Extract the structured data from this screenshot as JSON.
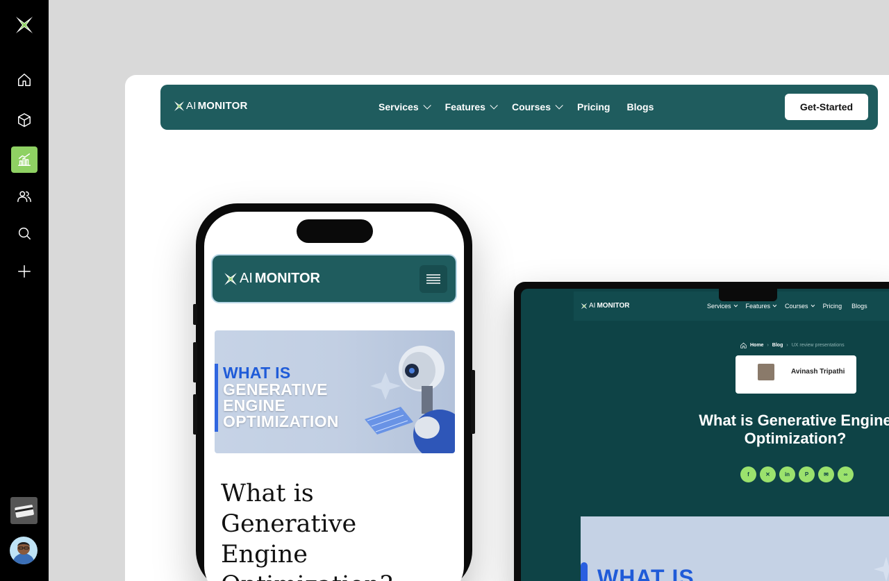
{
  "app_sidebar": {
    "items": [
      {
        "name": "home",
        "icon": "home-icon"
      },
      {
        "name": "products",
        "icon": "box-icon"
      },
      {
        "name": "analytics",
        "icon": "chart-icon",
        "active": true
      },
      {
        "name": "users",
        "icon": "users-icon"
      },
      {
        "name": "search",
        "icon": "search-icon"
      },
      {
        "name": "add",
        "icon": "plus-icon"
      }
    ],
    "accent_color": "#8fd163"
  },
  "site": {
    "logo_ai": "AI",
    "logo_name": "MONITOR",
    "nav": {
      "services": "Services",
      "features": "Features",
      "courses": "Courses",
      "pricing": "Pricing",
      "blogs": "Blogs"
    },
    "cta": "Get-Started",
    "brand_color": "#1f5c5e"
  },
  "phone": {
    "hero_line1": "WHAT IS",
    "hero_line2": "GENERATIVE",
    "hero_line3": "ENGINE",
    "hero_line4": "OPTIMIZATION",
    "title": "What is Generative Engine Optimization?"
  },
  "laptop": {
    "breadcrumb": {
      "home": "Home",
      "blog": "Blog",
      "current": "UX review presentations"
    },
    "author": "Avinash Tripathi",
    "title_line1": "What is Generative Engine",
    "title_line2": "Optimization?",
    "share_icons": [
      "facebook-icon",
      "x-icon",
      "linkedin-icon",
      "pinterest-icon",
      "email-icon",
      "link-icon"
    ],
    "hero_text": "WHAT IS"
  }
}
